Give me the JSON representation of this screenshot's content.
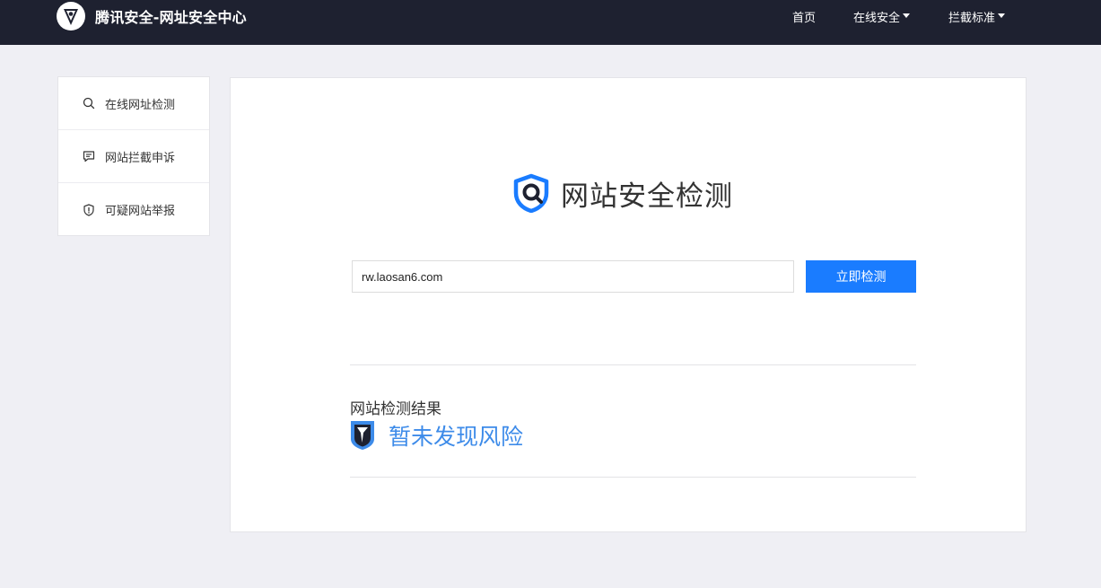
{
  "header": {
    "brand_title": "腾讯安全-网址安全中心",
    "nav": {
      "home": "首页",
      "online_security": "在线安全",
      "block_standard": "拦截标准"
    }
  },
  "sidebar": {
    "items": [
      {
        "label": "在线网址检测",
        "icon": "search-icon"
      },
      {
        "label": "网站拦截申诉",
        "icon": "chat-icon"
      },
      {
        "label": "可疑网站举报",
        "icon": "shield-alert-icon"
      }
    ]
  },
  "main": {
    "hero_title": "网站安全检测",
    "url_input": {
      "value": "rw.laosan6.com"
    },
    "check_button_label": "立即检测",
    "result_label": "网站检测结果",
    "result_text": "暂未发现风险"
  },
  "colors": {
    "topbar": "#1e2130",
    "accent": "#1a7cff",
    "result_text": "#3d8be9",
    "background": "#efeff4"
  }
}
